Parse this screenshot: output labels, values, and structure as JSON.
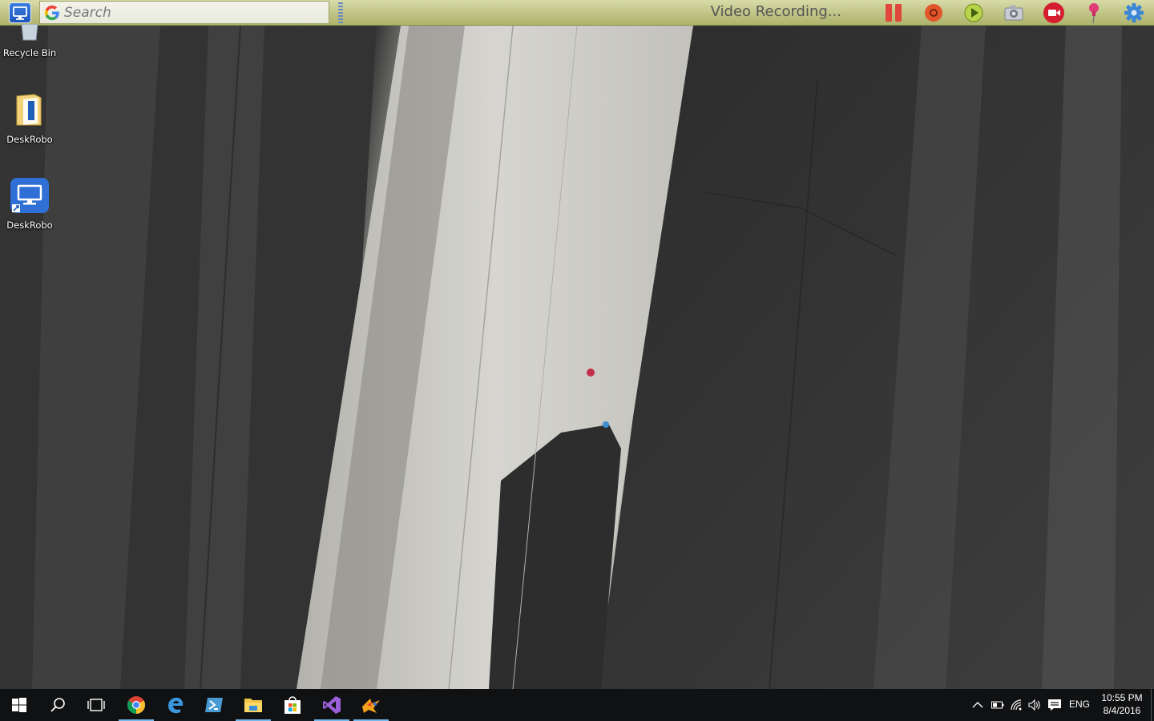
{
  "toolbar": {
    "search_placeholder": "Search",
    "status_text": "Video Recording...",
    "buttons": [
      "pause",
      "record",
      "play",
      "screenshot",
      "stop-record",
      "pin",
      "settings"
    ]
  },
  "desktop": {
    "icons": [
      {
        "label": "Recycle Bin",
        "icon": "recycle-bin-icon"
      },
      {
        "label": "DeskRobo",
        "icon": "folder-icon"
      },
      {
        "label": "DeskRobo",
        "icon": "monitor-shortcut-icon"
      }
    ]
  },
  "taskbar": {
    "pinned": [
      {
        "name": "start",
        "icon": "windows-logo-icon"
      },
      {
        "name": "search",
        "icon": "search-icon"
      },
      {
        "name": "task-view",
        "icon": "task-view-icon"
      },
      {
        "name": "chrome",
        "icon": "chrome-icon",
        "running": true
      },
      {
        "name": "edge",
        "icon": "edge-icon"
      },
      {
        "name": "powershell",
        "icon": "powershell-icon"
      },
      {
        "name": "file-explorer",
        "icon": "folder-icon",
        "running": true
      },
      {
        "name": "store",
        "icon": "store-icon"
      },
      {
        "name": "visual-studio",
        "icon": "visual-studio-icon",
        "running": true
      },
      {
        "name": "paint-app",
        "icon": "paint-icon",
        "running": true
      }
    ],
    "tray": {
      "language": "ENG",
      "time": "10:55 PM",
      "date": "8/4/2016"
    }
  },
  "colors": {
    "toolbar_bg": "#bfc486",
    "taskbar_bg": "#101113",
    "running_indicator": "#76b9ed"
  }
}
